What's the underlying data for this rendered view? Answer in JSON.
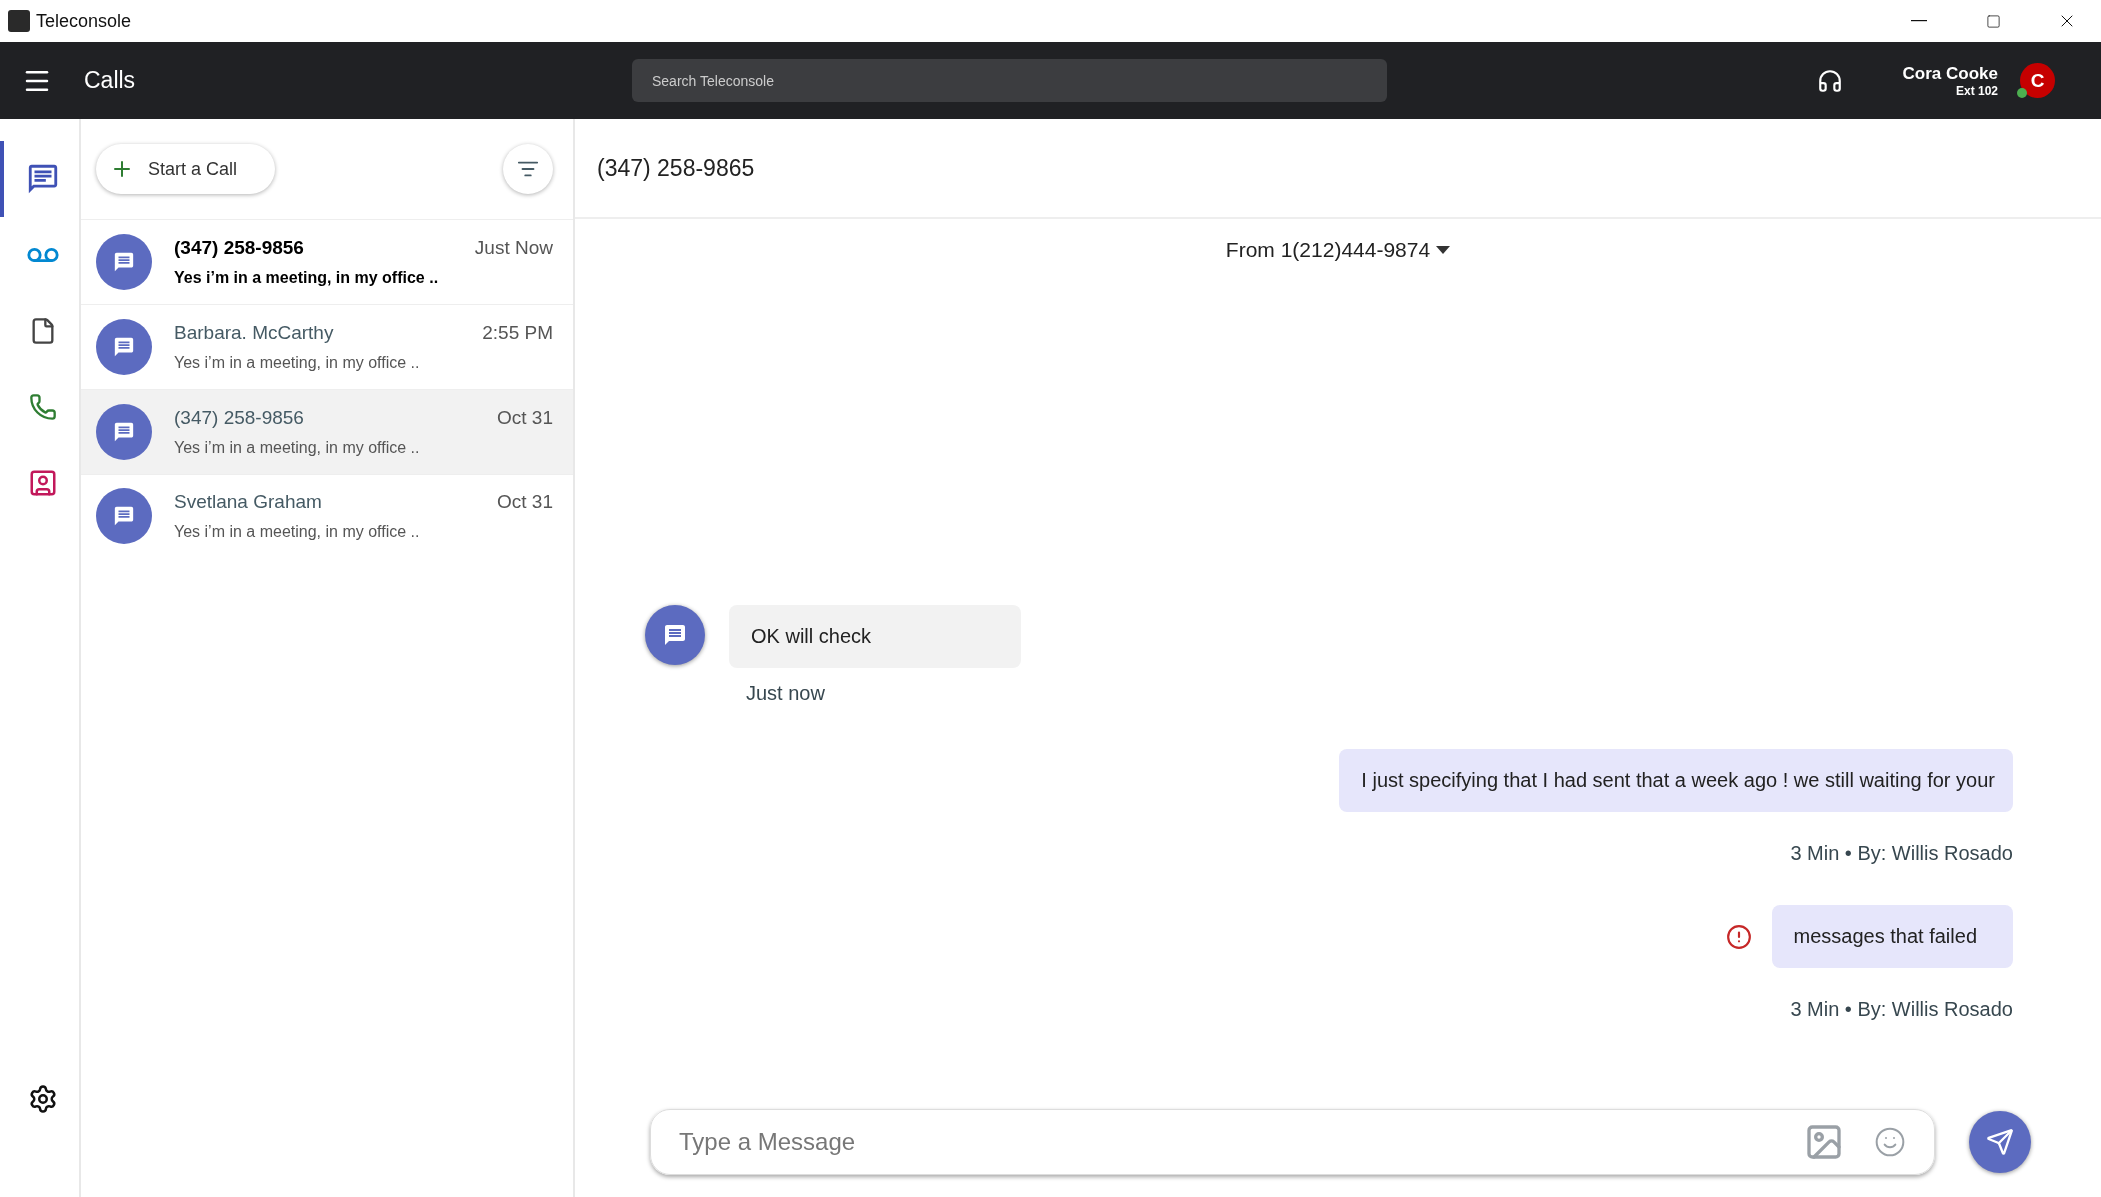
{
  "window": {
    "title": "Teleconsole"
  },
  "header": {
    "title": "Calls",
    "search": {
      "placeholder": "Search Teleconsole"
    },
    "user": {
      "name": "Cora Cooke",
      "ext": "Ext 102",
      "initial": "C",
      "online": true
    }
  },
  "rail": {
    "items": [
      {
        "kind": "messages",
        "selected": true
      },
      {
        "kind": "voicemail",
        "selected": false
      },
      {
        "kind": "files",
        "selected": false
      },
      {
        "kind": "calls",
        "selected": false
      },
      {
        "kind": "contacts",
        "selected": false
      }
    ]
  },
  "list": {
    "start_button": "Start a Call",
    "conversations": [
      {
        "name": "(347) 258-9856",
        "time": "Just Now",
        "preview": "Yes i’m in a meeting, in my office ..",
        "unread": true,
        "selected": false
      },
      {
        "name": "Barbara. McCarthy",
        "time": "2:55 PM",
        "preview": "Yes i’m in a meeting, in my office ..",
        "unread": false,
        "selected": false
      },
      {
        "name": "(347) 258-9856",
        "time": "Oct 31",
        "preview": "Yes i’m in a meeting, in my office ..",
        "unread": false,
        "selected": true
      },
      {
        "name": "Svetlana Graham",
        "time": "Oct 31",
        "preview": "Yes i’m in a meeting, in my office ..",
        "unread": false,
        "selected": false
      }
    ]
  },
  "chat": {
    "title": "(347) 258-9865",
    "from": "From 1(212)444-9874",
    "messages": [
      {
        "kind": "incoming",
        "text": "OK will check",
        "meta": "Just now"
      },
      {
        "kind": "outgoing",
        "text": "I just specifying that I had sent  that a week ago ! we still waiting for your",
        "meta": "3 Min • By: Willis Rosado",
        "failed": false
      },
      {
        "kind": "outgoing",
        "text": "messages that failed",
        "meta": "3 Min • By: Willis Rosado",
        "failed": true
      }
    ],
    "composer": {
      "placeholder": "Type a Message"
    }
  }
}
